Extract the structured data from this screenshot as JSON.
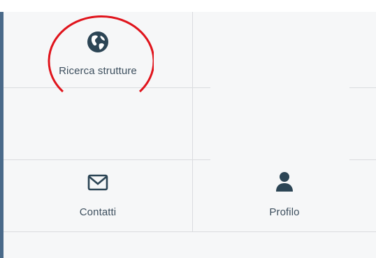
{
  "tiles": [
    {
      "label": "Ricerca strutture",
      "icon": "globe-icon"
    },
    {
      "label": "Contatti",
      "icon": "envelope-icon"
    },
    {
      "label": "Profilo",
      "icon": "user-icon"
    }
  ],
  "colors": {
    "icon": "#2c4555",
    "label": "#3d4f5e",
    "divider": "#dadcdf",
    "panel_background": "#f6f7f8",
    "left_border": "#4a6a8a",
    "highlight": "#e0141c"
  }
}
